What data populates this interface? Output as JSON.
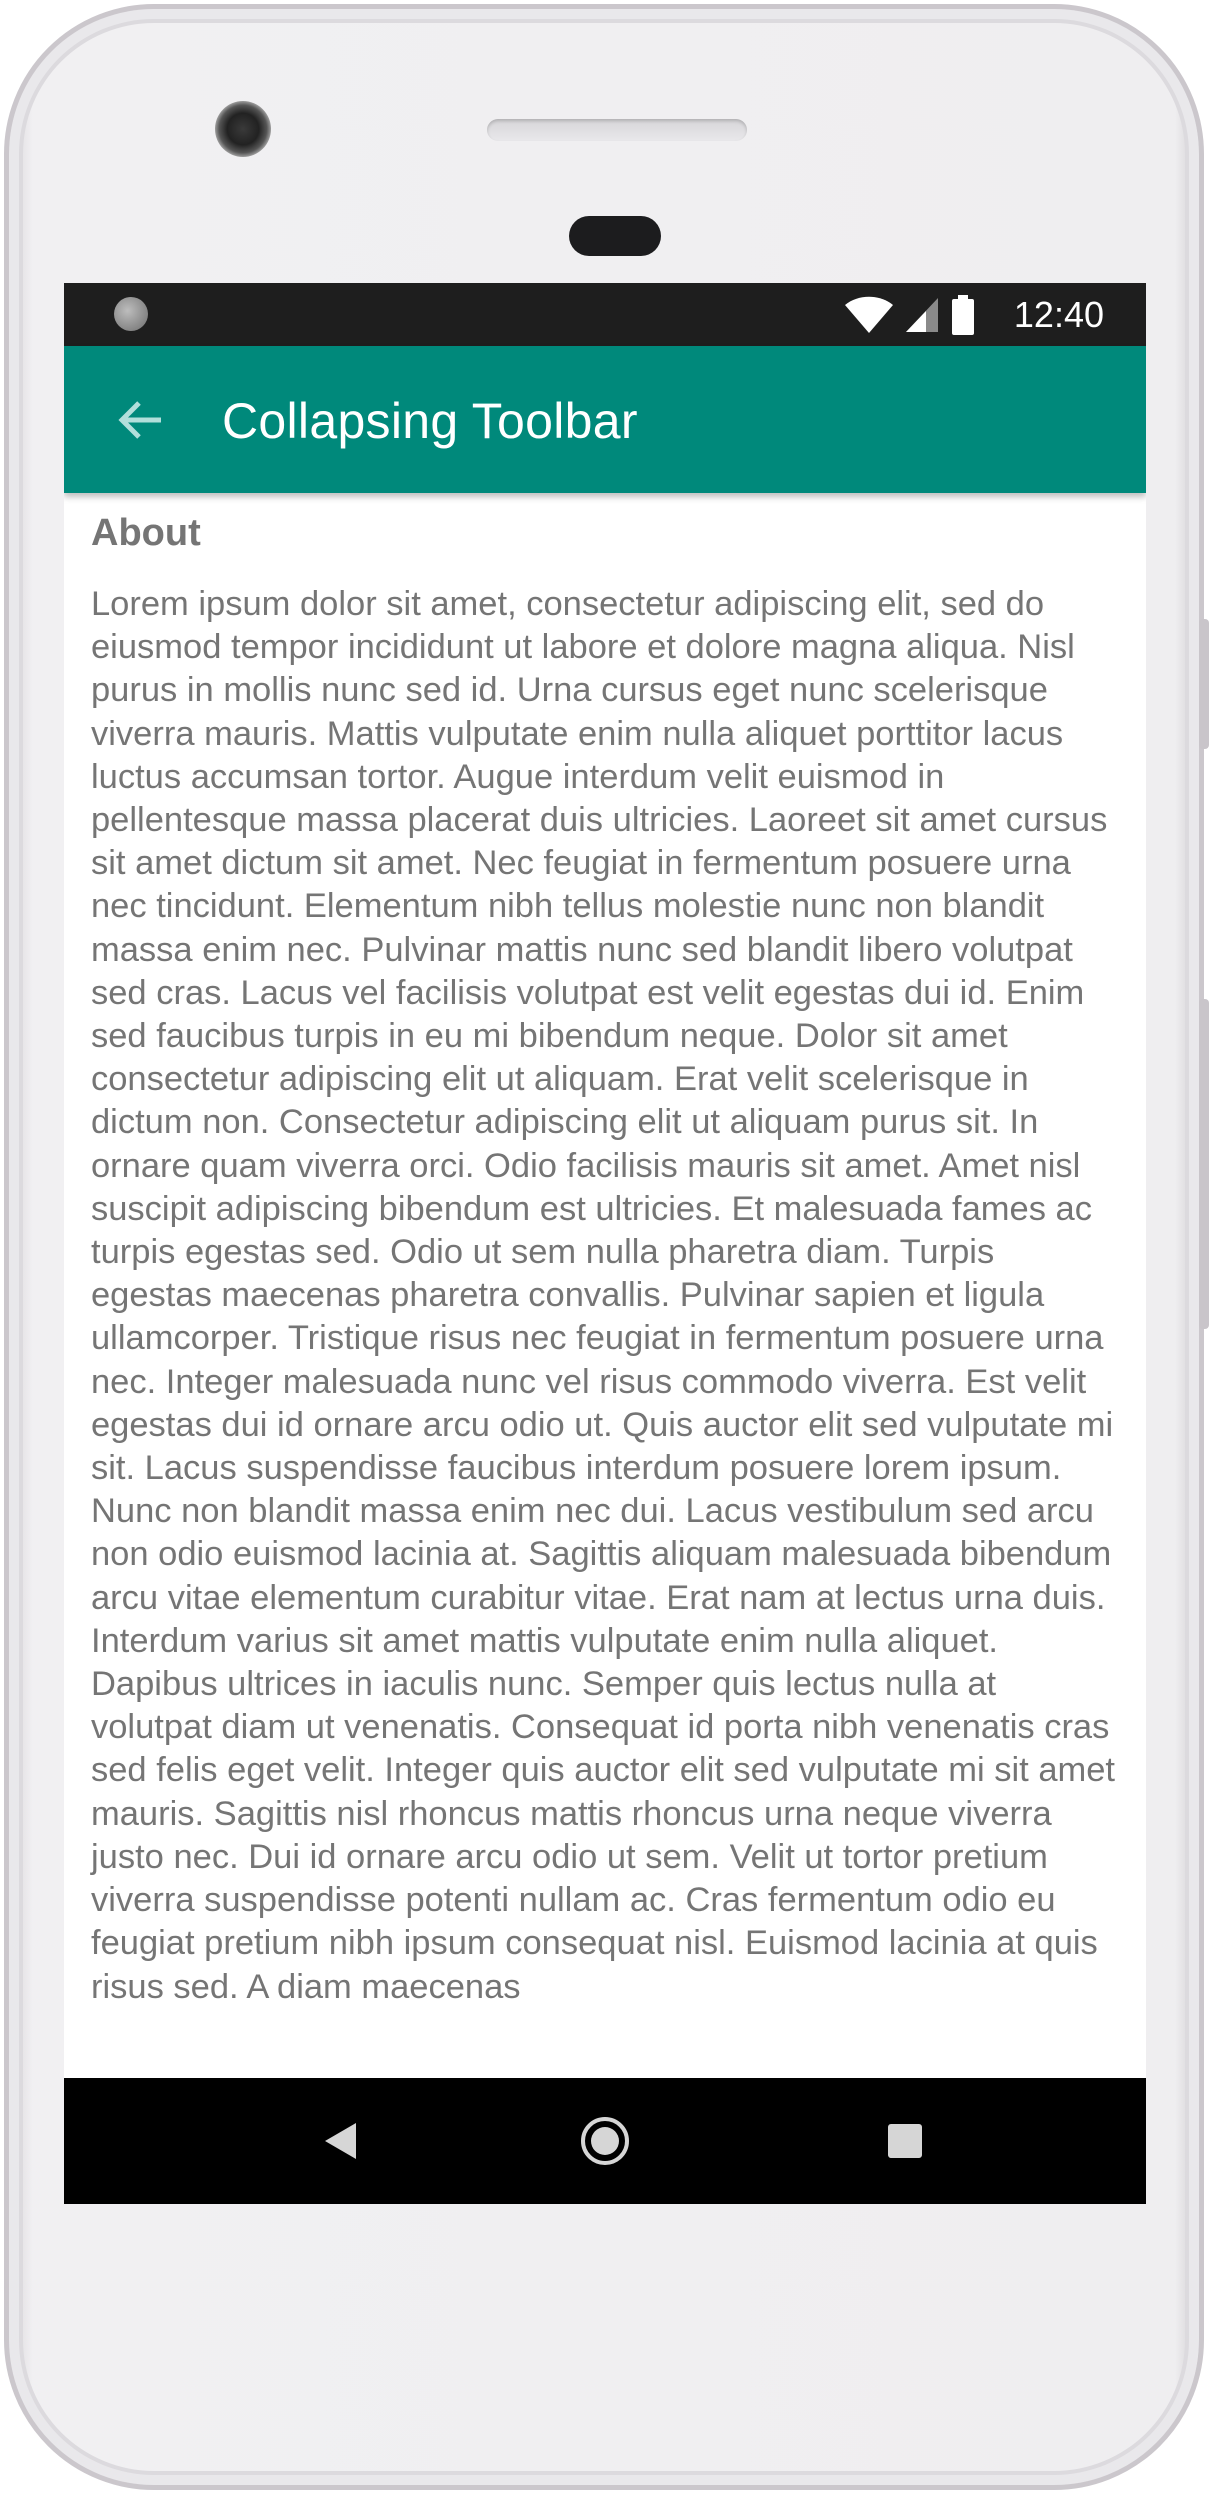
{
  "status_bar": {
    "time": "12:40",
    "icons": [
      "notification-dot-icon",
      "wifi-icon",
      "cell-signal-icon",
      "battery-icon"
    ]
  },
  "app_bar": {
    "title": "Collapsing Toolbar",
    "back_icon": "arrow-back-icon",
    "color": "#00897b"
  },
  "content": {
    "heading": "About",
    "body": "Lorem ipsum dolor sit amet, consectetur adipiscing elit, sed do eiusmod tempor incididunt ut labore et dolore magna aliqua. Nisl purus in mollis nunc sed id. Urna cursus eget nunc scelerisque viverra mauris. Mattis vulputate enim nulla aliquet porttitor lacus luctus accumsan tortor. Augue interdum velit euismod in pellentesque massa placerat duis ultricies. Laoreet sit amet cursus sit amet dictum sit amet. Nec feugiat in fermentum posuere urna nec tincidunt. Elementum nibh tellus molestie nunc non blandit massa enim nec. Pulvinar mattis nunc sed blandit libero volutpat sed cras. Lacus vel facilisis volutpat est velit egestas dui id. Enim sed faucibus turpis in eu mi bibendum neque. Dolor sit amet consectetur adipiscing elit ut aliquam. Erat velit scelerisque in dictum non. Consectetur adipiscing elit ut aliquam purus sit. In ornare quam viverra orci. Odio facilisis mauris sit amet. Amet nisl suscipit adipiscing bibendum est ultricies. Et malesuada fames ac turpis egestas sed. Odio ut sem nulla pharetra diam. Turpis egestas maecenas pharetra convallis. Pulvinar sapien et ligula ullamcorper. Tristique risus nec feugiat in fermentum posuere urna nec. Integer malesuada nunc vel risus commodo viverra. Est velit egestas dui id ornare arcu odio ut. Quis auctor elit sed vulputate mi sit. Lacus suspendisse faucibus interdum posuere lorem ipsum. Nunc non blandit massa enim nec dui. Lacus vestibulum sed arcu non odio euismod lacinia at. Sagittis aliquam malesuada bibendum arcu vitae elementum curabitur vitae. Erat nam at lectus urna duis. Interdum varius sit amet mattis vulputate enim nulla aliquet. Dapibus ultrices in iaculis nunc. Semper quis lectus nulla at volutpat diam ut venenatis. Consequat id porta nibh venenatis cras sed felis eget velit. Integer quis auctor elit sed vulputate mi sit amet mauris. Sagittis nisl rhoncus mattis rhoncus urna neque viverra justo nec. Dui id ornare arcu odio ut sem. Velit ut tortor pretium viverra suspendisse potenti nullam ac. Cras fermentum odio eu feugiat pretium nibh ipsum consequat nisl. Euismod lacinia at quis risus sed. A diam maecenas"
  },
  "nav_bar": {
    "back_icon": "nav-back-icon",
    "home_icon": "nav-home-icon",
    "recents_icon": "nav-recents-icon"
  }
}
